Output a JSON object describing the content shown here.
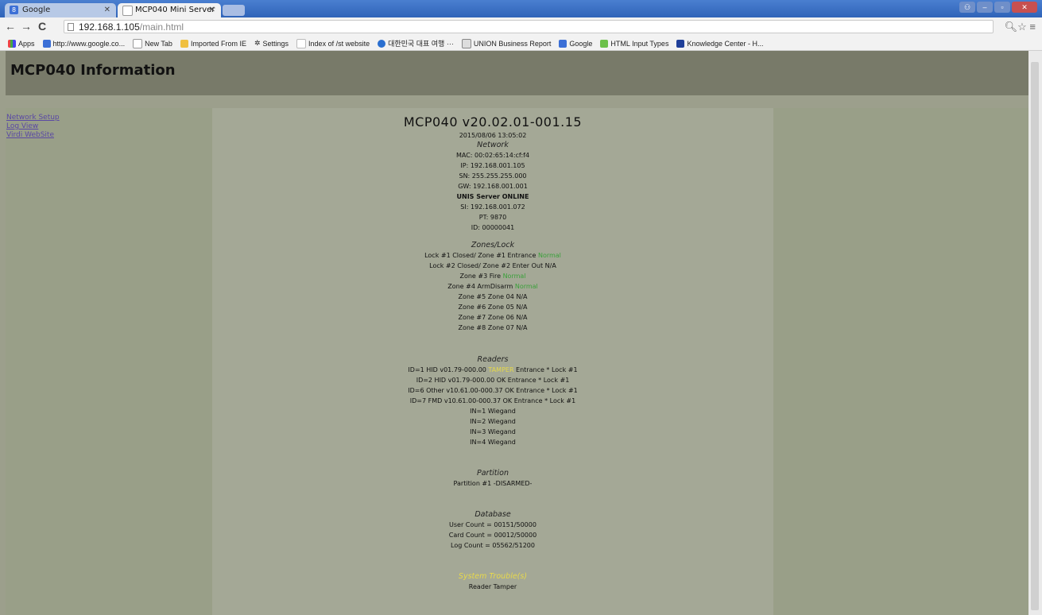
{
  "browser": {
    "tabs": [
      {
        "label": "Google",
        "active": false
      },
      {
        "label": "MCP040 Mini Server",
        "active": true
      }
    ],
    "url": {
      "host": "192.168.1.105",
      "path": "/main.html"
    },
    "bookmarks": [
      {
        "label": "Apps",
        "icon": "apps-grid-icon"
      },
      {
        "label": "http://www.google.co...",
        "icon": "google-icon"
      },
      {
        "label": "New Tab",
        "icon": "page-icon"
      },
      {
        "label": "Imported From IE",
        "icon": "folder-icon"
      },
      {
        "label": "Settings",
        "icon": "gear-icon"
      },
      {
        "label": "Index of /st website",
        "icon": "page-icon"
      },
      {
        "label": "대한민국 대표 여행 ···",
        "icon": "globe-icon"
      },
      {
        "label": "UNION Business Report",
        "icon": "chart-icon"
      },
      {
        "label": "Google",
        "icon": "google-icon"
      },
      {
        "label": "HTML Input Types",
        "icon": "html5-icon"
      },
      {
        "label": "Knowledge Center - H...",
        "icon": "knowledge-icon"
      }
    ]
  },
  "page": {
    "title": "MCP040 Information",
    "nav": [
      "Network Setup",
      "Log View",
      "Virdi WebSite"
    ],
    "version": "MCP040 v20.02.01-001.15",
    "datetime": "2015/08/06 13:05:02",
    "network": {
      "heading": "Network",
      "mac": "MAC: 00:02:65:14:cf:f4",
      "ip": "IP: 192.168.001.105",
      "sn": "SN: 255.255.255.000",
      "gw": "GW: 192.168.001.001",
      "server_status": "UNIS Server ONLINE",
      "si": "SI: 192.168.001.072",
      "pt": "PT: 9870",
      "id": "ID: 00000041"
    },
    "zones": {
      "heading": "Zones/Lock",
      "lines": [
        {
          "text": "Lock #1 Closed/ Zone #1 Entrance ",
          "status": "Normal"
        },
        {
          "text": "Lock #2 Closed/ Zone #2 Enter Out N/A",
          "status": ""
        },
        {
          "text": "Zone #3 Fire ",
          "status": "Normal"
        },
        {
          "text": "Zone #4 ArmDisarm ",
          "status": "Normal"
        },
        {
          "text": "Zone #5 Zone 04 N/A",
          "status": ""
        },
        {
          "text": "Zone #6 Zone 05 N/A",
          "status": ""
        },
        {
          "text": "Zone #7 Zone 06 N/A",
          "status": ""
        },
        {
          "text": "Zone #8 Zone 07 N/A",
          "status": ""
        }
      ]
    },
    "readers": {
      "heading": "Readers",
      "r1_pre": "ID=1 HID v01.79-000.00 ",
      "r1_flag": "TAMPER",
      "r1_post": " Entrance * Lock #1",
      "lines": [
        "ID=2 HID v01.79-000.00 OK Entrance * Lock #1",
        "ID=6 Other v10.61.00-000.37 OK Entrance * Lock #1",
        "ID=7 FMD v10.61.00-000.37 OK Entrance * Lock #1",
        "IN=1 Wiegand",
        "IN=2 Wiegand",
        "IN=3 Wiegand",
        "IN=4 Wiegand"
      ]
    },
    "partition": {
      "heading": "Partition",
      "line": "Partition #1 -DISARMED-"
    },
    "database": {
      "heading": "Database",
      "user": "User Count = 00151/50000",
      "card": "Card Count = 00012/50000",
      "log": "Log Count = 05562/51200"
    },
    "trouble": {
      "heading": "System Trouble(s)",
      "line": "Reader Tamper"
    }
  },
  "colors": {
    "header_bg": "#787a69",
    "side_bg": "#999f88",
    "center_bg": "#a4a896",
    "ok": "#3aa03a",
    "warning": "#e8d94b",
    "link": "#5a48a4"
  }
}
